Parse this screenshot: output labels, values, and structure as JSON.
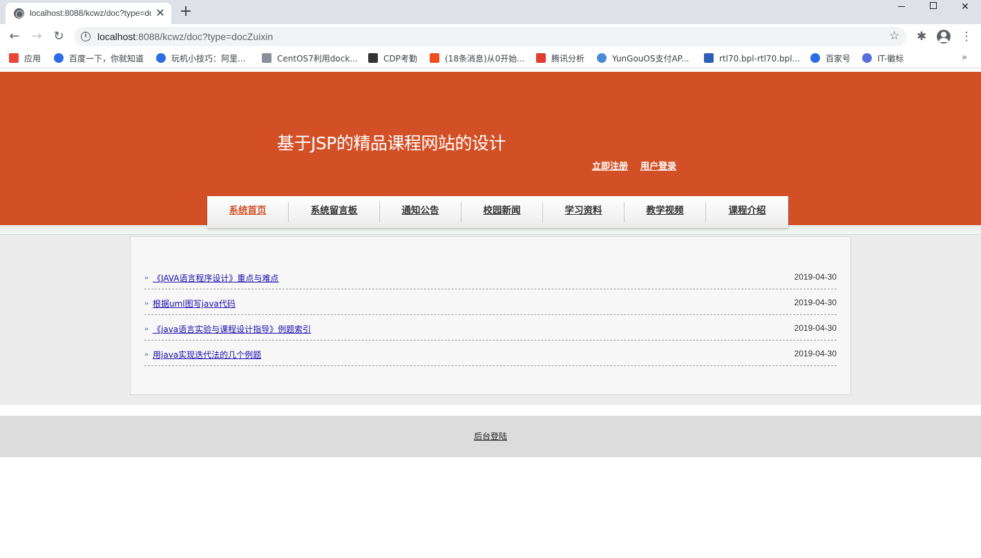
{
  "browser": {
    "tab_title": "localhost:8088/kcwz/doc?type=docZuixin",
    "tab_close": "✕",
    "new_tab": "+",
    "url_host": "localhost",
    "url_rest": ":8088/kcwz/doc?type=docZuixin",
    "bookmarks": [
      {
        "label": "应用",
        "icon": "apps-grid-icon",
        "color": "#e8453c"
      },
      {
        "label": "百度一下，你就知道",
        "icon": "baidu-paw-icon",
        "color": "#2b6de5"
      },
      {
        "label": "玩机小技巧：阿里...",
        "icon": "baidu-paw-icon",
        "color": "#2b6de5"
      },
      {
        "label": "CentOS7利用dock...",
        "icon": "site-thumbnail-icon",
        "color": "#8a8f99"
      },
      {
        "label": "CDP考勤",
        "icon": "chart-icon",
        "color": "#333333"
      },
      {
        "label": "(18条消息)从0开始...",
        "icon": "csdn-c-icon",
        "color": "#f04d23"
      },
      {
        "label": "腾讯分析",
        "icon": "tencent-icon",
        "color": "#e33b2e"
      },
      {
        "label": "YunGouOS支付AP...",
        "icon": "yungou-icon",
        "color": "#4a8bd6"
      },
      {
        "label": "rtl70.bpl-rtl70.bpl...",
        "icon": "feather-icon",
        "color": "#2f5fb3"
      },
      {
        "label": "百家号",
        "icon": "baidu-paw-icon",
        "color": "#2b6de5"
      },
      {
        "label": "IT-徽标",
        "icon": "c-circle-icon",
        "color": "#5a6ee0"
      }
    ],
    "bookmarks_more": "»"
  },
  "site": {
    "title": "基于JSP的精品课程网站的设计",
    "register_link": "立即注册",
    "login_link": "用户登录",
    "accent_color": "#d35027",
    "nav": [
      {
        "label": "系统首页",
        "active": true
      },
      {
        "label": "系统留言板",
        "active": false
      },
      {
        "label": "通知公告",
        "active": false
      },
      {
        "label": "校园新闻",
        "active": false
      },
      {
        "label": "学习资料",
        "active": false
      },
      {
        "label": "教学视频",
        "active": false
      },
      {
        "label": "课程介绍",
        "active": false
      }
    ],
    "docs": [
      {
        "title": "《JAVA语言程序设计》重点与难点",
        "date": "2019-04-30"
      },
      {
        "title": "根据uml图写java代码",
        "date": "2019-04-30"
      },
      {
        "title": "《java语言实验与课程设计指导》例题索引",
        "date": "2019-04-30"
      },
      {
        "title": "用java实现迭代法的几个例题",
        "date": "2019-04-30"
      }
    ],
    "footer_link": "后台登陆"
  }
}
